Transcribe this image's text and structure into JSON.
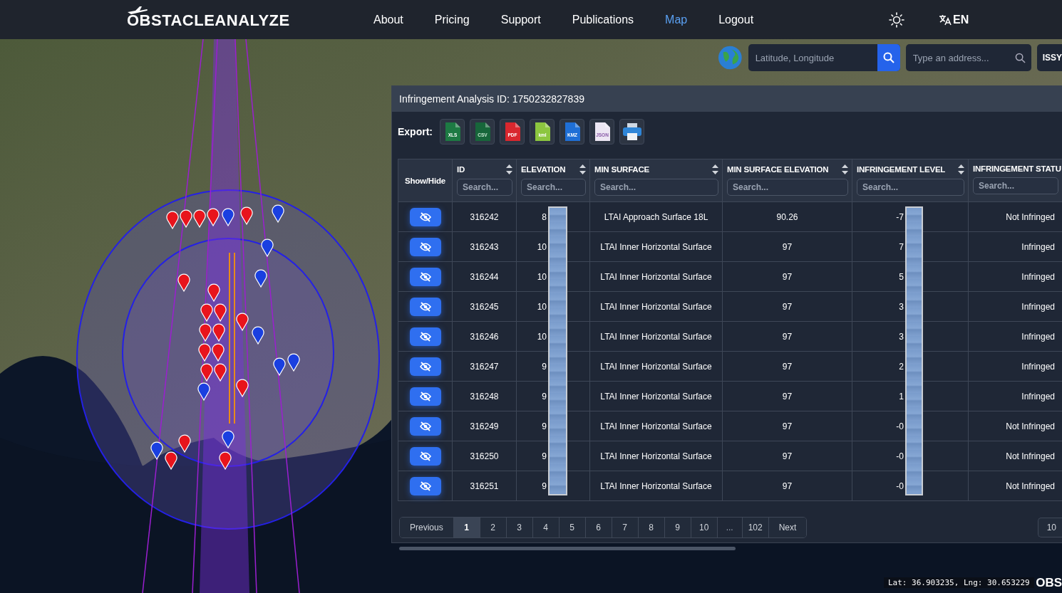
{
  "header": {
    "logo": "OBSTACLEANALYZE",
    "nav": [
      {
        "label": "About",
        "selected": false
      },
      {
        "label": "Pricing",
        "selected": false
      },
      {
        "label": "Support",
        "selected": false
      },
      {
        "label": "Publications",
        "selected": false
      },
      {
        "label": "Map",
        "selected": true
      },
      {
        "label": "Logout",
        "selected": false
      }
    ],
    "language": "EN"
  },
  "map_search": {
    "coordinates": {
      "placeholder": "Latitude, Longitude"
    },
    "address": {
      "placeholder": "Type an address..."
    },
    "extra_button": "ISSY"
  },
  "panel": {
    "title": "Infringement Analysis ID: 1750232827839",
    "export_label": "Export:",
    "export_buttons": [
      {
        "kind": "xls",
        "label": "XLS"
      },
      {
        "kind": "csv",
        "label": "CSV"
      },
      {
        "kind": "pdf",
        "label": "PDF"
      },
      {
        "kind": "kml",
        "label": "kml"
      },
      {
        "kind": "kmz",
        "label": "KMZ"
      },
      {
        "kind": "json",
        "label": "JSON"
      },
      {
        "kind": "print"
      }
    ],
    "table": {
      "columns": [
        {
          "label": "Show/Hide",
          "sortable": false
        },
        {
          "label": "ID",
          "sortable": true,
          "search_placeholder": "Search..."
        },
        {
          "label": "ELEVATION",
          "sortable": true,
          "search_placeholder": "Search..."
        },
        {
          "label": "MIN SURFACE",
          "sortable": true,
          "search_placeholder": "Search..."
        },
        {
          "label": "MIN SURFACE ELEVATION",
          "sortable": true,
          "search_placeholder": "Search..."
        },
        {
          "label": "INFRINGEMENT LEVEL",
          "sortable": true,
          "search_placeholder": "Search..."
        },
        {
          "label": "INFRINGEMENT STATU",
          "sortable": false,
          "search_placeholder": "Search..."
        }
      ],
      "rows": [
        {
          "id": "316242",
          "elevation": "8",
          "min_surface": "LTAI Approach Surface 18L",
          "min_surface_elevation": "90.26",
          "infringement_level": "-7",
          "status": "Not Infringed"
        },
        {
          "id": "316243",
          "elevation": "10",
          "min_surface": "LTAI Inner Horizontal Surface",
          "min_surface_elevation": "97",
          "infringement_level": "7",
          "status": "Infringed"
        },
        {
          "id": "316244",
          "elevation": "10",
          "min_surface": "LTAI Inner Horizontal Surface",
          "min_surface_elevation": "97",
          "infringement_level": "5",
          "status": "Infringed"
        },
        {
          "id": "316245",
          "elevation": "10",
          "min_surface": "LTAI Inner Horizontal Surface",
          "min_surface_elevation": "97",
          "infringement_level": "3",
          "status": "Infringed"
        },
        {
          "id": "316246",
          "elevation": "10",
          "min_surface": "LTAI Inner Horizontal Surface",
          "min_surface_elevation": "97",
          "infringement_level": "3",
          "status": "Infringed"
        },
        {
          "id": "316247",
          "elevation": "9",
          "min_surface": "LTAI Inner Horizontal Surface",
          "min_surface_elevation": "97",
          "infringement_level": "2",
          "status": "Infringed"
        },
        {
          "id": "316248",
          "elevation": "9",
          "min_surface": "LTAI Inner Horizontal Surface",
          "min_surface_elevation": "97",
          "infringement_level": "1",
          "status": "Infringed"
        },
        {
          "id": "316249",
          "elevation": "9",
          "min_surface": "LTAI Inner Horizontal Surface",
          "min_surface_elevation": "97",
          "infringement_level": "-0",
          "status": "Not Infringed"
        },
        {
          "id": "316250",
          "elevation": "9",
          "min_surface": "LTAI Inner Horizontal Surface",
          "min_surface_elevation": "97",
          "infringement_level": "-0",
          "status": "Not Infringed"
        },
        {
          "id": "316251",
          "elevation": "9",
          "min_surface": "LTAI Inner Horizontal Surface",
          "min_surface_elevation": "97",
          "infringement_level": "-0",
          "status": "Not Infringed"
        }
      ]
    },
    "pagination": {
      "previous": "Previous",
      "next": "Next",
      "page_size": "10",
      "pages": [
        {
          "kind": "page",
          "label": "1",
          "selected": true
        },
        {
          "kind": "page",
          "label": "2",
          "selected": false
        },
        {
          "kind": "page",
          "label": "3",
          "selected": false
        },
        {
          "kind": "page",
          "label": "4",
          "selected": false
        },
        {
          "kind": "page",
          "label": "5",
          "selected": false
        },
        {
          "kind": "page",
          "label": "6",
          "selected": false
        },
        {
          "kind": "page",
          "label": "7",
          "selected": false
        },
        {
          "kind": "page",
          "label": "8",
          "selected": false
        },
        {
          "kind": "page",
          "label": "9",
          "selected": false
        },
        {
          "kind": "page",
          "label": "10",
          "selected": false
        },
        {
          "kind": "ellipsis",
          "label": "..."
        },
        {
          "kind": "page",
          "label": "102",
          "selected": false
        }
      ]
    }
  },
  "status_bar": {
    "coordinates": "Lat: 36.903235, Lng: 30.653229",
    "logo": "OBS"
  }
}
